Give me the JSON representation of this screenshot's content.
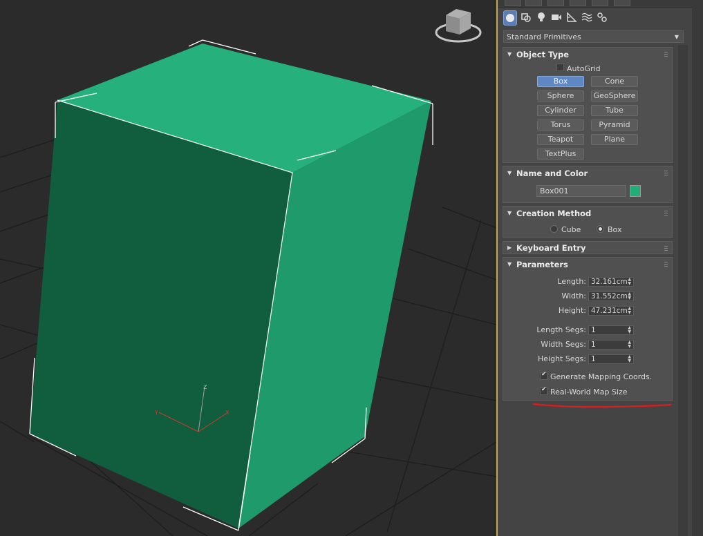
{
  "viewport": {
    "object_color": "#22ad78",
    "axis_labels": {
      "x": "X",
      "y": "Y",
      "z": "Z"
    }
  },
  "command_panel": {
    "category_icons": [
      "sphere-icon",
      "shapes-icon",
      "light-icon",
      "camera-icon",
      "helper-icon",
      "spacewarp-icon",
      "systems-icon"
    ],
    "active_category": "sphere-icon",
    "dropdown": {
      "value": "Standard Primitives"
    },
    "object_type": {
      "title": "Object Type",
      "autogrid_label": "AutoGrid",
      "autogrid_checked": false,
      "buttons": [
        "Box",
        "Cone",
        "Sphere",
        "GeoSphere",
        "Cylinder",
        "Tube",
        "Torus",
        "Pyramid",
        "Teapot",
        "Plane",
        "TextPlus"
      ],
      "selected": "Box"
    },
    "name_and_color": {
      "title": "Name and Color",
      "name": "Box001",
      "color": "#22ad78"
    },
    "creation_method": {
      "title": "Creation Method",
      "options": [
        "Cube",
        "Box"
      ],
      "selected": "Box"
    },
    "keyboard_entry": {
      "title": "Keyboard Entry"
    },
    "parameters": {
      "title": "Parameters",
      "length_label": "Length:",
      "length": "32.161cm",
      "width_label": "Width:",
      "width": "31.552cm",
      "height_label": "Height:",
      "height": "47.231cm",
      "length_segs_label": "Length Segs:",
      "length_segs": "1",
      "width_segs_label": "Width Segs:",
      "width_segs": "1",
      "height_segs_label": "Height Segs:",
      "height_segs": "1",
      "gen_mapping_label": "Generate Mapping Coords.",
      "gen_mapping_checked": true,
      "real_world_label": "Real-World Map Size",
      "real_world_checked": true
    },
    "annotation_color": "#d02020"
  }
}
